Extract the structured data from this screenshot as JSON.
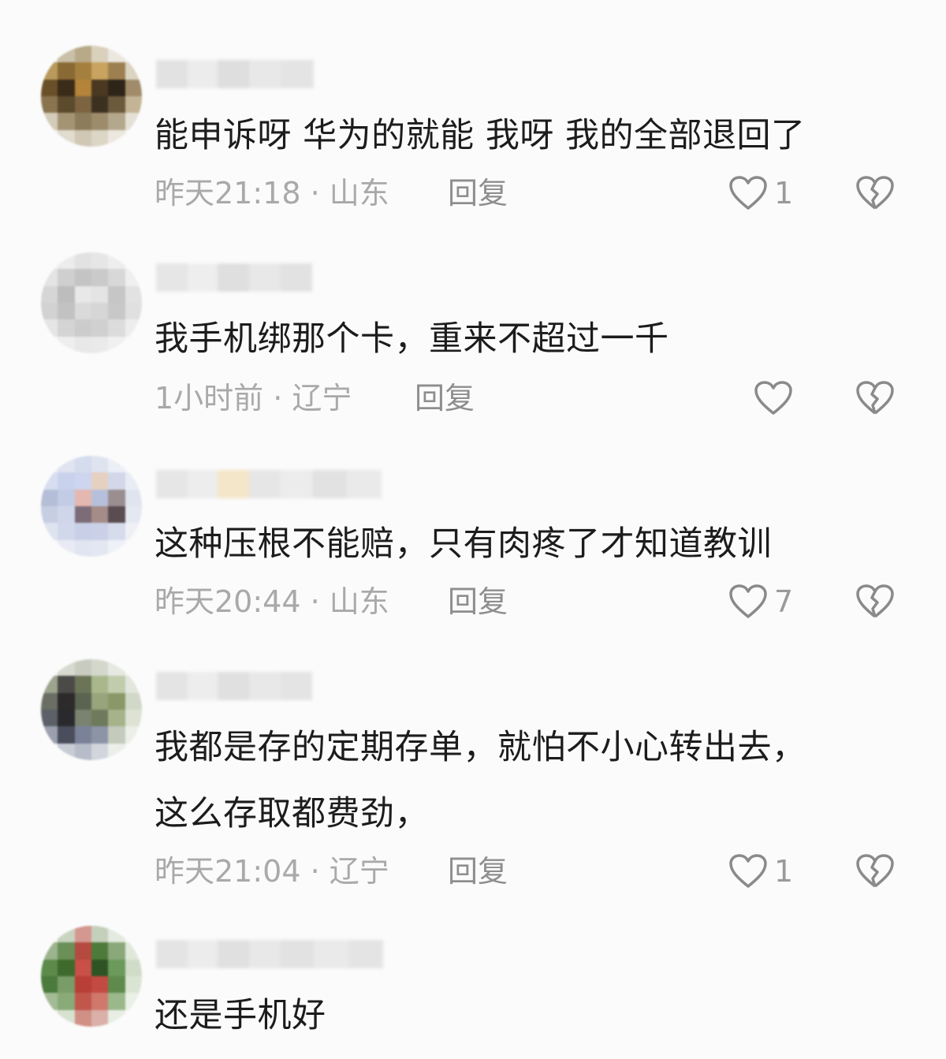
{
  "comments": [
    {
      "text": "能申诉呀 华为的就能 我呀 我的全部退回了",
      "time_location": "昨天21:18 · 山东",
      "reply_label": "回复",
      "like_count": "1"
    },
    {
      "text": "我手机绑那个卡，重来不超过一千",
      "time_location": "1小时前 · 辽宁",
      "reply_label": "回复",
      "like_count": ""
    },
    {
      "text": "这种压根不能赔，只有肉疼了才知道教训",
      "time_location": "昨天20:44 · 山东",
      "reply_label": "回复",
      "like_count": "7"
    },
    {
      "text": "我都是存的定期存单，就怕不小心转出去，\n这么存取都费劲，",
      "time_location": "昨天21:04 · 辽宁",
      "reply_label": "回复",
      "like_count": "1"
    },
    {
      "text": "还是手机好",
      "time_location": "",
      "reply_label": "",
      "like_count": ""
    }
  ],
  "icons": {
    "like": "heart-outline-icon",
    "dislike": "broken-heart-icon"
  },
  "colors": {
    "background": "#fbfbfb",
    "text": "#1c1c1c",
    "meta": "#a9a9a9",
    "icon": "#8a8a8a"
  }
}
